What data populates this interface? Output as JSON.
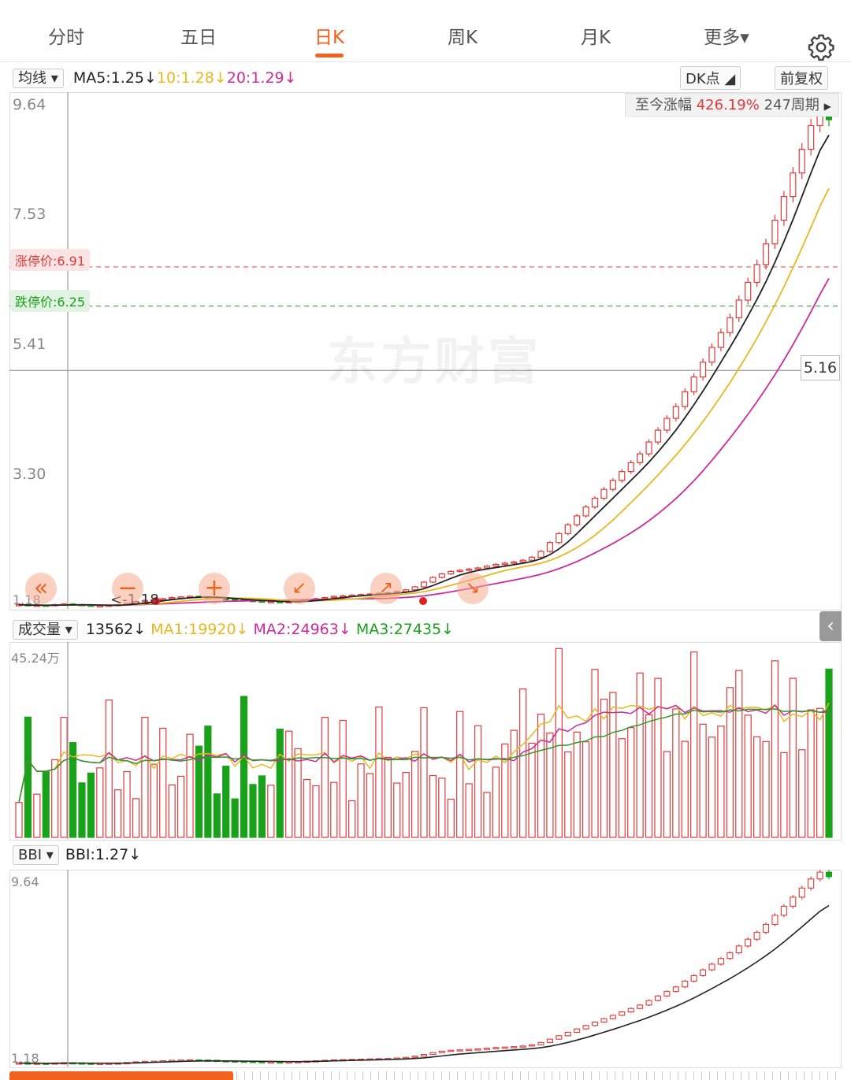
{
  "tabs": [
    {
      "label": "分时",
      "active": false
    },
    {
      "label": "五日",
      "active": false
    },
    {
      "label": "日K",
      "active": true
    },
    {
      "label": "周K",
      "active": false
    },
    {
      "label": "月K",
      "active": false
    },
    {
      "label": "更多▾",
      "active": false
    }
  ],
  "settings_icon": "gear-icon",
  "ma_bar": {
    "selector": "均线",
    "ma5": "MA5:1.25↓",
    "ma10": "10:1.28↓",
    "ma20": "20:1.29↓",
    "dk_button": "DK点",
    "fq_button": "前复权"
  },
  "main_chart": {
    "y_ticks": [
      "9.64",
      "7.53",
      "5.41",
      "3.30",
      "1.18"
    ],
    "limit_up": "涨停价:6.91",
    "limit_down": "跌停价:6.25",
    "range_label": "至今涨幅",
    "range_pct": "426.19%",
    "range_periods": "247周期",
    "crosshair_value": "5.16",
    "low_marker": "<-1.18",
    "watermark": "东方财富"
  },
  "volume_bar": {
    "selector": "成交量",
    "vol": "13562↓",
    "ma1": "MA1:19920↓",
    "ma2": "MA2:24963↓",
    "ma3": "MA3:27435↓",
    "max_label": "45.24万"
  },
  "bbi_bar": {
    "selector": "BBI",
    "bbi": "BBI:1.27↓",
    "y_top": "9.64",
    "y_bottom": "1.18"
  },
  "colors": {
    "accent": "#f0621e",
    "up": "#e03a3a",
    "down": "#1aa11a",
    "ma5": "#222222",
    "ma10": "#e8b820",
    "ma20": "#cc2a9c"
  },
  "chart_data": {
    "type": "candlestick",
    "y_range": [
      1.18,
      9.64
    ],
    "price_path": [
      1.2,
      1.18,
      1.19,
      1.18,
      1.2,
      1.21,
      1.2,
      1.19,
      1.18,
      1.18,
      1.19,
      1.2,
      1.22,
      1.25,
      1.27,
      1.28,
      1.3,
      1.32,
      1.33,
      1.34,
      1.33,
      1.32,
      1.3,
      1.29,
      1.28,
      1.27,
      1.26,
      1.25,
      1.25,
      1.24,
      1.25,
      1.26,
      1.28,
      1.3,
      1.32,
      1.34,
      1.35,
      1.36,
      1.37,
      1.38,
      1.39,
      1.4,
      1.42,
      1.45,
      1.5,
      1.58,
      1.66,
      1.72,
      1.76,
      1.78,
      1.8,
      1.82,
      1.85,
      1.88,
      1.9,
      1.92,
      1.95,
      2.0,
      2.1,
      2.25,
      2.4,
      2.55,
      2.7,
      2.85,
      3.0,
      3.15,
      3.3,
      3.45,
      3.6,
      3.75,
      3.95,
      4.15,
      4.35,
      4.55,
      4.8,
      5.05,
      5.3,
      5.55,
      5.8,
      6.05,
      6.35,
      6.65,
      6.95,
      7.3,
      7.7,
      8.1,
      8.5,
      8.9,
      9.3,
      9.6,
      9.4
    ],
    "volume_max": 452400
  }
}
